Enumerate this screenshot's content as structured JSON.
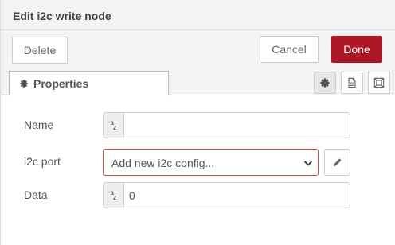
{
  "tray": {
    "title": "Edit i2c write node"
  },
  "toolbar": {
    "delete_label": "Delete",
    "cancel_label": "Cancel",
    "done_label": "Done"
  },
  "tabs": {
    "active": {
      "label": "Properties",
      "icon": "cog-icon"
    },
    "icon_buttons": [
      "cog-icon",
      "file-text-icon",
      "frame-icon"
    ]
  },
  "form": {
    "name": {
      "label": "Name",
      "value": "",
      "type_badge_a": "a",
      "type_badge_z": "z"
    },
    "port": {
      "label": "i2c port",
      "selected": "Add new i2c config...",
      "edit_icon": "pencil-icon"
    },
    "data": {
      "label": "Data",
      "value": "0",
      "type_badge_a": "a",
      "type_badge_z": "z"
    }
  },
  "colors": {
    "primary": "#ad1625",
    "error_border": "#c84c4c",
    "header_bg": "#f3f3f3"
  }
}
